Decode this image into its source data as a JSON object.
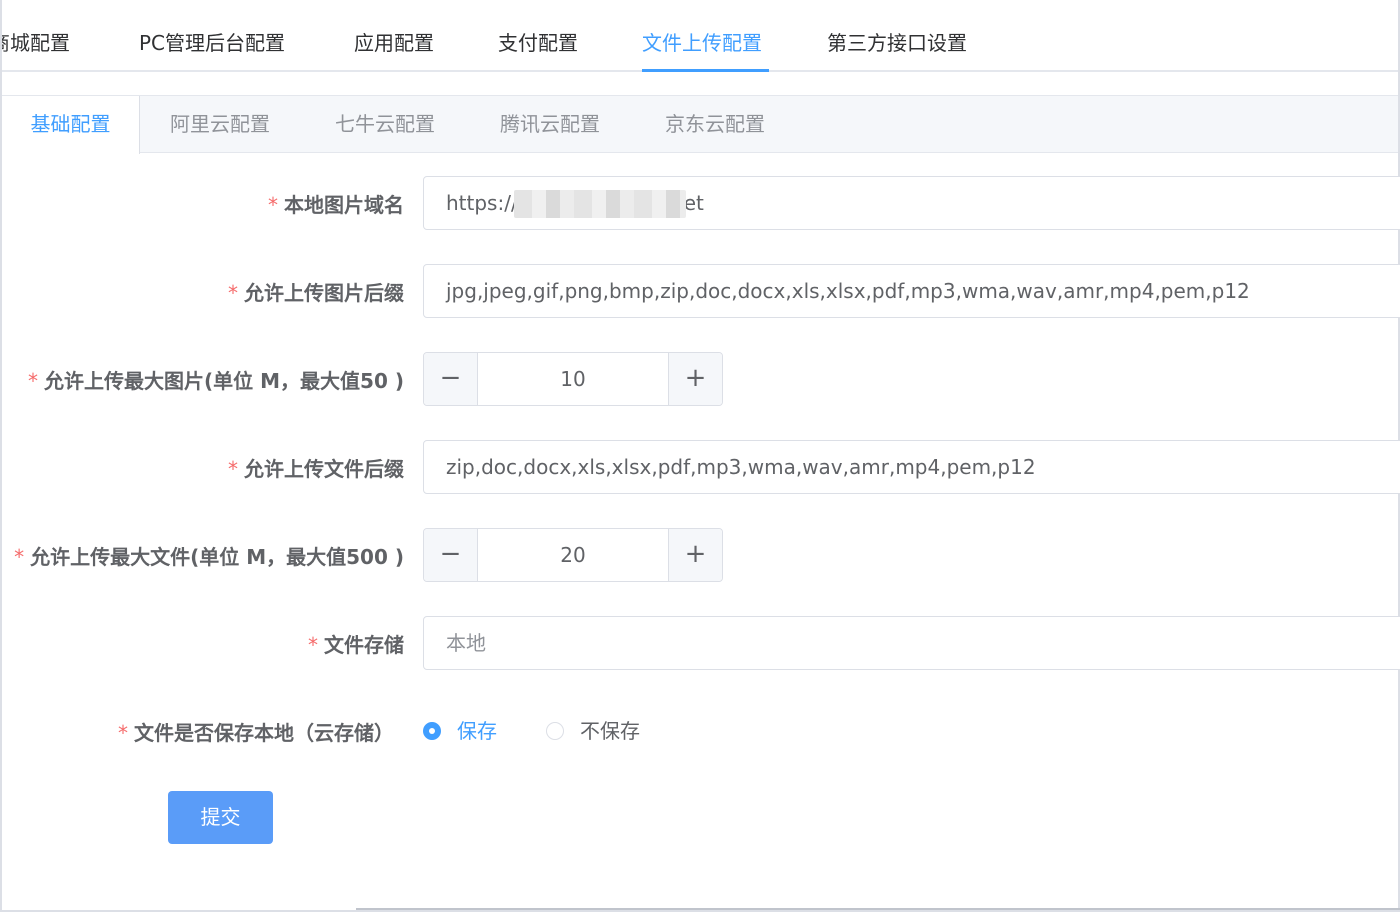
{
  "top_tabs": [
    {
      "label": "商城配置"
    },
    {
      "label": "PC管理后台配置"
    },
    {
      "label": "应用配置"
    },
    {
      "label": "支付配置"
    },
    {
      "label": "文件上传配置"
    },
    {
      "label": "第三方接口设置"
    }
  ],
  "top_tabs_active": "文件上传配置",
  "sub_tabs": [
    {
      "label": "基础配置"
    },
    {
      "label": "阿里云配置"
    },
    {
      "label": "七牛云配置"
    },
    {
      "label": "腾讯云配置"
    },
    {
      "label": "京东云配置"
    }
  ],
  "sub_tabs_active": "基础配置",
  "form": {
    "required_mark": "*",
    "image_domain": {
      "label": "本地图片域名",
      "value_prefix": "https://",
      "value_suffix": "et"
    },
    "image_ext": {
      "label": "允许上传图片后缀",
      "value": "jpg,jpeg,gif,png,bmp,zip,doc,docx,xls,xlsx,pdf,mp3,wma,wav,amr,mp4,pem,p12"
    },
    "image_max": {
      "label": "允许上传最大图片(单位 M，最大值50 )",
      "value": "10",
      "minus": "−",
      "plus": "+"
    },
    "file_ext": {
      "label": "允许上传文件后缀",
      "value": "zip,doc,docx,xls,xlsx,pdf,mp3,wma,wav,amr,mp4,pem,p12"
    },
    "file_max": {
      "label": "允许上传最大文件(单位 M，最大值500 )",
      "value": "20",
      "minus": "−",
      "plus": "+"
    },
    "storage": {
      "label": "文件存储",
      "value": "本地"
    },
    "keep_local": {
      "label": "文件是否保存本地（云存储）",
      "options": [
        "保存",
        "不保存"
      ],
      "selected": "保存"
    },
    "submit_label": "提交"
  },
  "colors": {
    "accent": "#409eff",
    "required": "#f56c6c",
    "submit": "#5a9cf8"
  }
}
